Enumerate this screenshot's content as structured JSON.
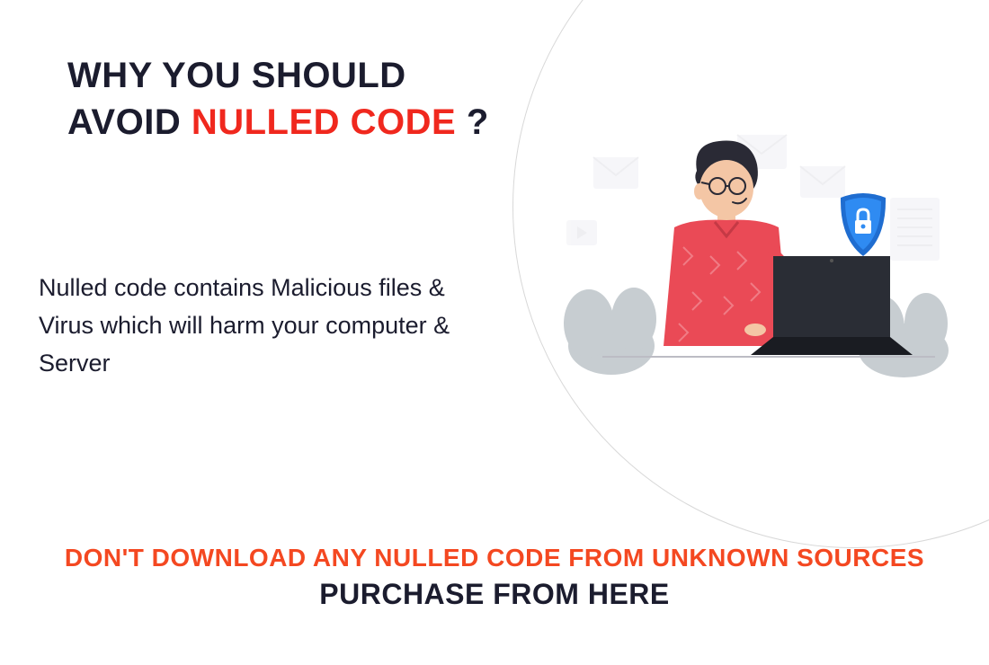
{
  "title": {
    "pre": "WHY YOU SHOULD",
    "mid1": "AVOID",
    "highlight": "NULLED CODE",
    "suffix": "?"
  },
  "body": "Nulled code contains Malicious files & Virus which will harm your computer & Server",
  "footer": {
    "top": "DON'T DOWNLOAD ANY NULLED CODE FROM UNKNOWN SOURCES",
    "bottom": "PURCHASE FROM HERE"
  },
  "icons": {
    "shield": "lock-shield-icon",
    "person": "person-laptop-illustration"
  },
  "colors": {
    "accent": "#f0281e",
    "footer_accent": "#f44821",
    "dark": "#1b1c2e"
  }
}
